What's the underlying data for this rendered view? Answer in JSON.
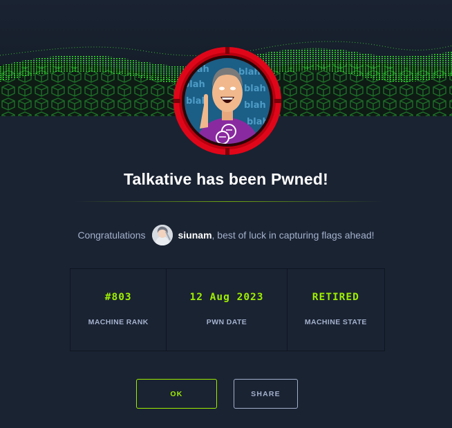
{
  "dialog": {
    "title": "Talkative has been Pwned!",
    "congrats_prefix": "Congratulations",
    "username": "siunam",
    "congrats_suffix": ", best of luck in capturing flags ahead!"
  },
  "avatar_text": "blah",
  "stats": [
    {
      "value": "#803",
      "label": "MACHINE RANK"
    },
    {
      "value": "12 Aug 2023",
      "label": "PWN DATE"
    },
    {
      "value": "RETIRED",
      "label": "MACHINE STATE"
    }
  ],
  "buttons": {
    "ok": "OK",
    "share": "SHARE"
  },
  "colors": {
    "background": "#1a2332",
    "accent": "#9fef00",
    "muted": "#a4b1cd",
    "ring": "#e0061a"
  }
}
